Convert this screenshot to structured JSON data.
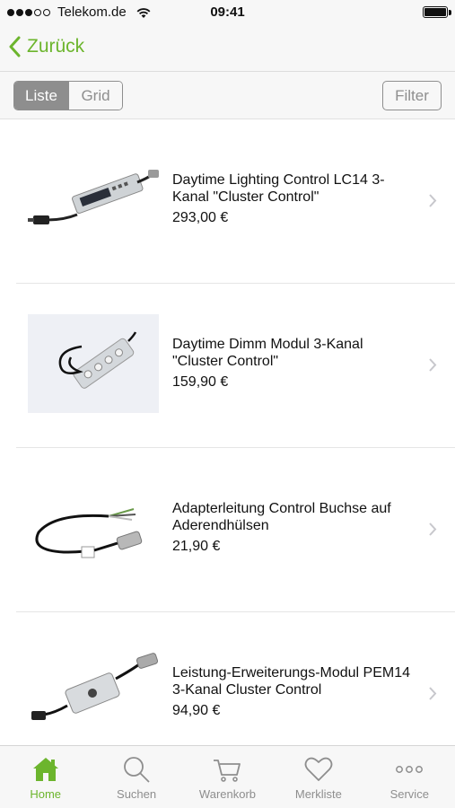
{
  "status_bar": {
    "carrier": "Telekom.de",
    "time": "09:41",
    "signal_bars": 3,
    "signal_total": 5
  },
  "nav": {
    "back_label": "Zurück"
  },
  "toolbar": {
    "segments": [
      {
        "label": "Liste",
        "selected": true
      },
      {
        "label": "Grid",
        "selected": false
      }
    ],
    "filter_label": "Filter"
  },
  "products": [
    {
      "name": "Daytime Lighting Control LC14 3-Kanal \"Cluster Control\"",
      "price": "293,00 €",
      "image": "controller-device-image"
    },
    {
      "name": "Daytime Dimm Modul 3-Kanal \"Cluster Control\"",
      "price": "159,90 €",
      "image": "dimm-module-image"
    },
    {
      "name": "Adapterleitung Control Buchse auf Aderendhülsen",
      "price": "21,90 €",
      "image": "adapter-cable-image"
    },
    {
      "name": "Leistung-Erweiterungs-Modul PEM14 3-Kanal Cluster Control",
      "price": "94,90 €",
      "image": "extension-module-image"
    }
  ],
  "tabs": [
    {
      "label": "Home",
      "icon": "home-icon",
      "active": true
    },
    {
      "label": "Suchen",
      "icon": "search-icon",
      "active": false
    },
    {
      "label": "Warenkorb",
      "icon": "cart-icon",
      "active": false
    },
    {
      "label": "Merkliste",
      "icon": "heart-icon",
      "active": false
    },
    {
      "label": "Service",
      "icon": "more-icon",
      "active": false
    }
  ],
  "colors": {
    "accent": "#6cb52d",
    "inactive": "#8e8e8e",
    "bar_background": "#f7f7f7"
  }
}
